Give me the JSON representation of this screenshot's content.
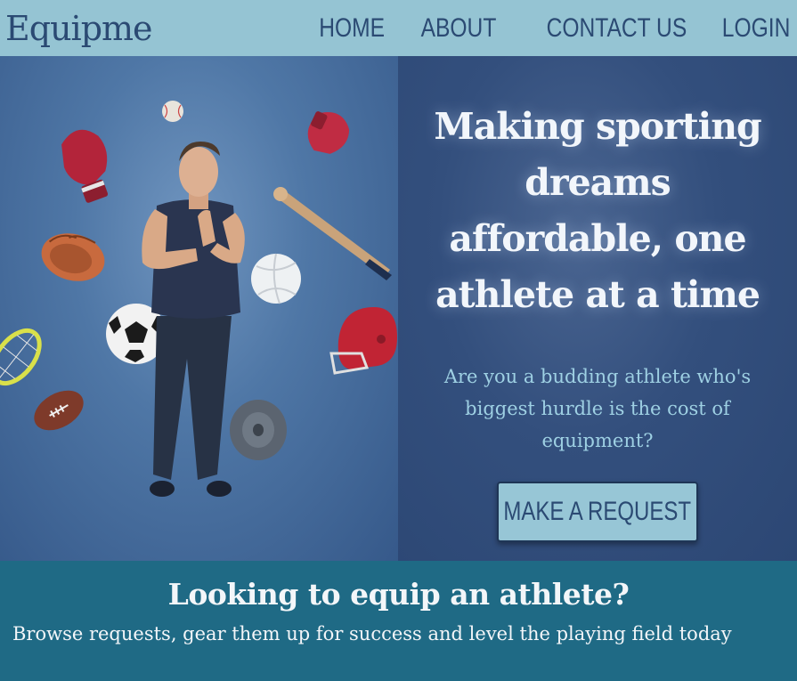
{
  "navbar": {
    "brand": "Equipme",
    "links": [
      "HOME",
      "ABOUT",
      "CONTACT US",
      "LOGIN"
    ]
  },
  "hero": {
    "title": "Making sporting dreams affordable, one athlete at a time",
    "subtitle": "Are you a budding athlete who's biggest hurdle is the cost of equipment?",
    "cta_label": "MAKE A REQUEST"
  },
  "section": {
    "title": "Looking to equip an athlete?",
    "text": "Browse requests, gear them up for success and level the playing field today"
  },
  "colors": {
    "nav_bg": "#95c4d3",
    "brand_text": "#2b4a73",
    "hero_bg": "#2f4b78",
    "hero_subtitle": "#9ed0e3",
    "section_bg": "#1f6a85",
    "button_bg": "#97c6d6"
  },
  "icons": [
    "boxing-glove-icon",
    "baseball-icon",
    "baseball-bat-icon",
    "baseball-mitt-icon",
    "volleyball-icon",
    "soccer-ball-icon",
    "tennis-racket-icon",
    "football-helmet-icon",
    "american-football-icon",
    "weight-plate-icon"
  ]
}
